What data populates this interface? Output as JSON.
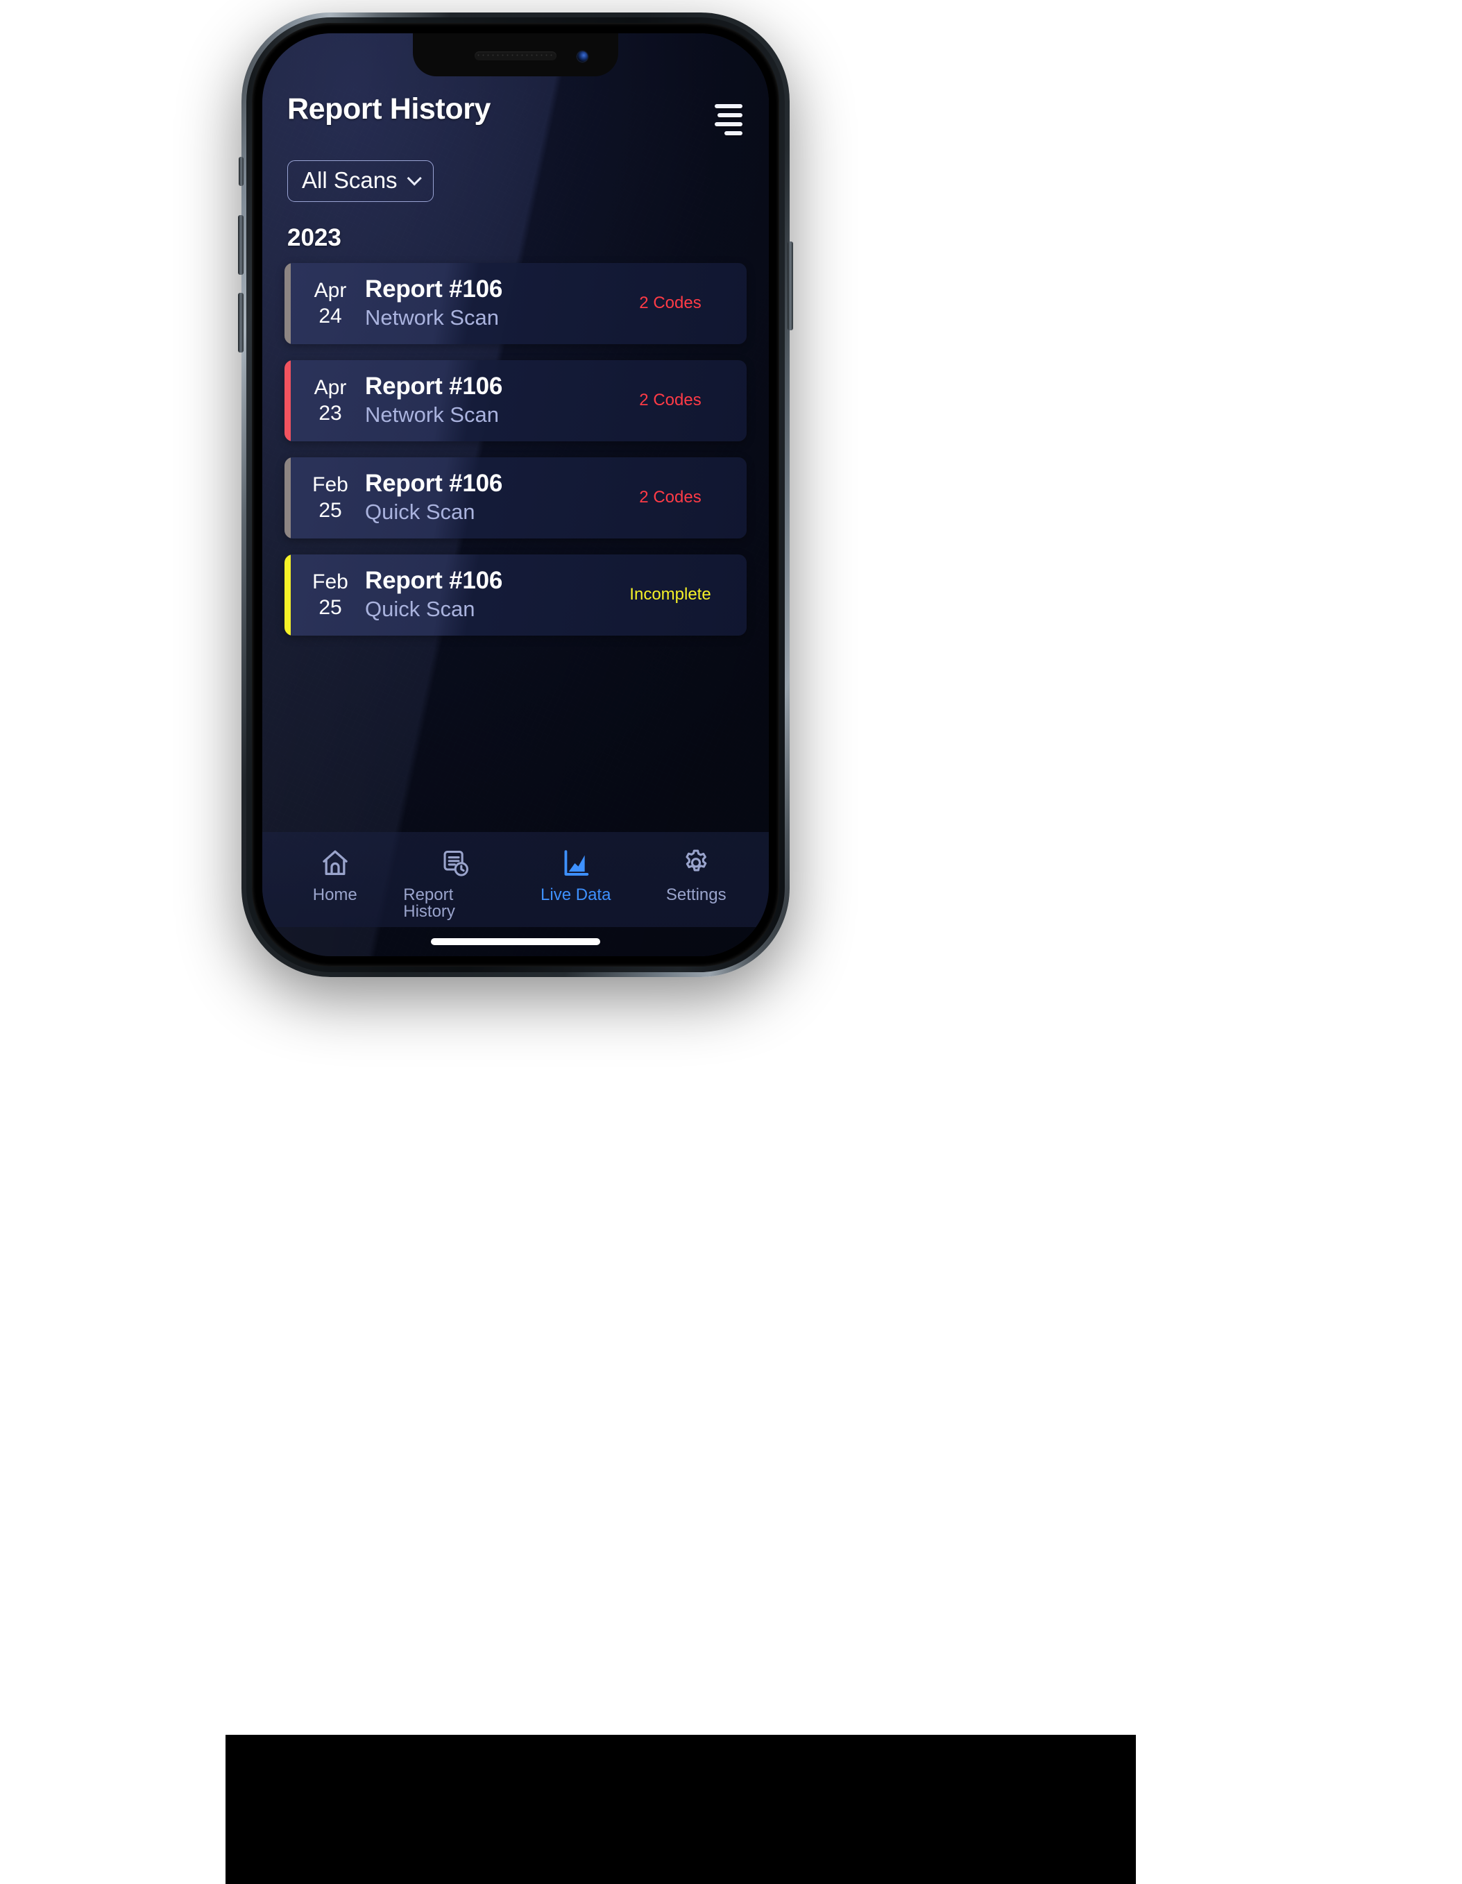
{
  "app": {
    "header": {
      "title": "Report History",
      "menu_icon": "hamburger-menu-icon"
    },
    "filter": {
      "selected": "All Scans",
      "chevron_icon": "chevron-down-icon"
    },
    "year_group": "2023",
    "reports": [
      {
        "month": "Apr",
        "day": "24",
        "title": "Report #106",
        "scan_type": "Network Scan",
        "status": "2 Codes",
        "status_color": "#ff3b46",
        "accent_color": "#8d8583"
      },
      {
        "month": "Apr",
        "day": "23",
        "title": "Report #106",
        "scan_type": "Network Scan",
        "status": "2 Codes",
        "status_color": "#ff3b46",
        "accent_color": "#f2535f"
      },
      {
        "month": "Feb",
        "day": "25",
        "title": "Report #106",
        "scan_type": "Quick Scan",
        "status": "2 Codes",
        "status_color": "#ff3b46",
        "accent_color": "#8d8583"
      },
      {
        "month": "Feb",
        "day": "25",
        "title": "Report #106",
        "scan_type": "Quick Scan",
        "status": "Incomplete",
        "status_color": "#f5f128",
        "accent_color": "#f5f128"
      }
    ],
    "tabbar": {
      "active": "Live Data",
      "items": [
        {
          "label": "Home",
          "icon": "home-icon"
        },
        {
          "label": "Report History",
          "icon": "document-clock-icon"
        },
        {
          "label": "Live Data",
          "icon": "bar-chart-icon"
        },
        {
          "label": "Settings",
          "icon": "gear-icon"
        }
      ]
    },
    "colors": {
      "accent_blue": "#3e91ff",
      "screen_bg": "#0d1228",
      "card_bg": "#222a4f",
      "muted_text": "#aab3de"
    }
  }
}
